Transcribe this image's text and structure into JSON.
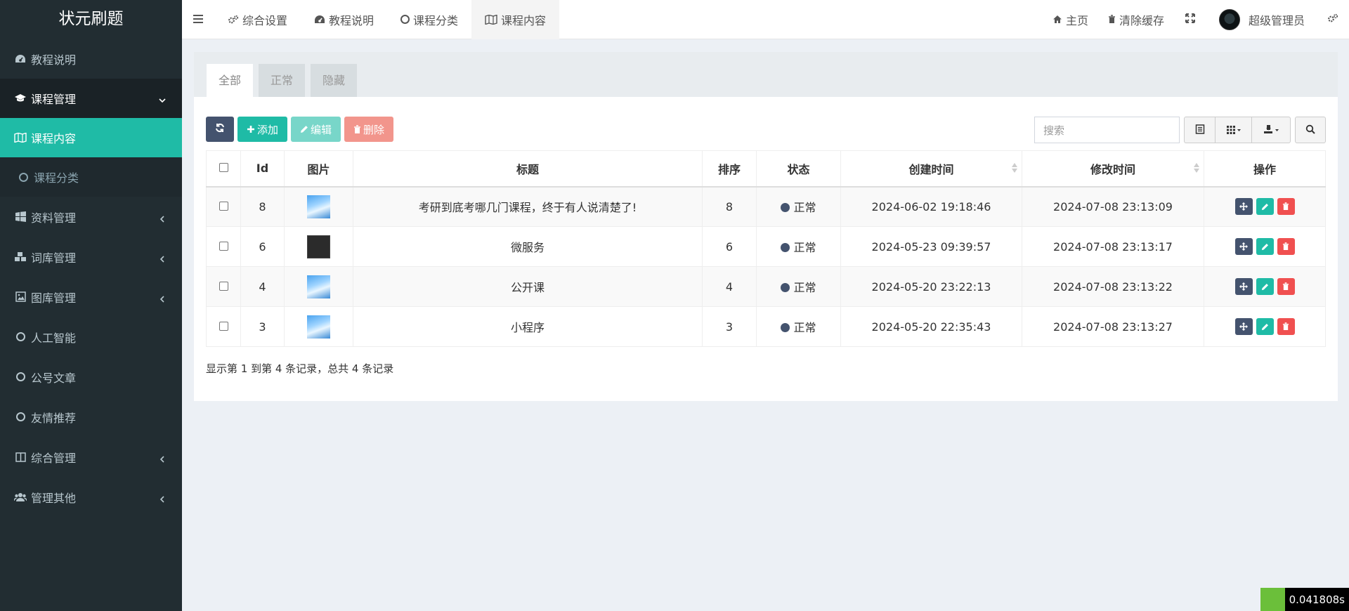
{
  "brand": "状元刷题",
  "sidebar": {
    "items": [
      {
        "label": "教程说明",
        "icon": "dashboard-icon"
      },
      {
        "label": "课程管理",
        "icon": "graduation-cap-icon"
      },
      {
        "label": "课程内容",
        "icon": "map-icon"
      },
      {
        "label": "课程分类",
        "icon": "circle-icon"
      },
      {
        "label": "资料管理",
        "icon": "windows-icon"
      },
      {
        "label": "词库管理",
        "icon": "cubes-icon"
      },
      {
        "label": "图库管理",
        "icon": "image-icon"
      },
      {
        "label": "人工智能",
        "icon": "circle-icon"
      },
      {
        "label": "公号文章",
        "icon": "circle-icon"
      },
      {
        "label": "友情推荐",
        "icon": "circle-icon"
      },
      {
        "label": "综合管理",
        "icon": "columns-icon"
      },
      {
        "label": "管理其他",
        "icon": "users-icon"
      }
    ]
  },
  "header": {
    "tabs": [
      {
        "label": "综合设置",
        "icon": "cogs-icon"
      },
      {
        "label": "教程说明",
        "icon": "dashboard-icon"
      },
      {
        "label": "课程分类",
        "icon": "circle-icon"
      },
      {
        "label": "课程内容",
        "icon": "map-icon"
      }
    ],
    "home": "主页",
    "clear_cache": "清除缓存",
    "user": "超级管理员"
  },
  "tabs": {
    "all": "全部",
    "normal": "正常",
    "hidden": "隐藏"
  },
  "toolbar": {
    "add": "添加",
    "edit": "编辑",
    "delete": "删除"
  },
  "search": {
    "placeholder": "搜索"
  },
  "table": {
    "columns": [
      "Id",
      "图片",
      "标题",
      "排序",
      "状态",
      "创建时间",
      "修改时间",
      "操作"
    ],
    "rows": [
      {
        "id": "8",
        "image": "blue",
        "title": "考研到底考哪几门课程，终于有人说清楚了!",
        "sort": "8",
        "status": "正常",
        "created": "2024-06-02 19:18:46",
        "modified": "2024-07-08 23:13:09"
      },
      {
        "id": "6",
        "image": "dark",
        "title": "微服务",
        "sort": "6",
        "status": "正常",
        "created": "2024-05-23 09:39:57",
        "modified": "2024-07-08 23:13:17"
      },
      {
        "id": "4",
        "image": "blue",
        "title": "公开课",
        "sort": "4",
        "status": "正常",
        "created": "2024-05-20 23:22:13",
        "modified": "2024-07-08 23:13:22"
      },
      {
        "id": "3",
        "image": "blue",
        "title": "小程序",
        "sort": "3",
        "status": "正常",
        "created": "2024-05-20 22:35:43",
        "modified": "2024-07-08 23:13:27"
      }
    ]
  },
  "pagination": {
    "info": "显示第 1 到第 4 条记录，总共 4 条记录"
  },
  "timer": "0.041808s",
  "colors": {
    "sidebar": "#222d32",
    "accent": "#1fbba6",
    "dark_button": "#44536e",
    "danger": "#f05050"
  }
}
